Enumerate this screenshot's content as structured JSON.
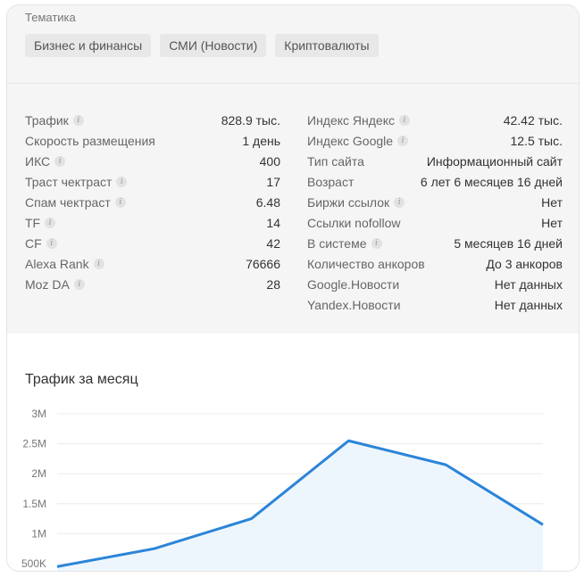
{
  "topics": {
    "title": "Тематика",
    "chips": [
      "Бизнес и финансы",
      "СМИ (Новости)",
      "Криптовалюты"
    ]
  },
  "stats": {
    "left": [
      {
        "label": "Трафик",
        "value": "828.9 тыс.",
        "info": true
      },
      {
        "label": "Скорость размещения",
        "value": "1 день",
        "info": false
      },
      {
        "label": "ИКС",
        "value": "400",
        "info": true
      },
      {
        "label": "Траст чектраст",
        "value": "17",
        "info": true
      },
      {
        "label": "Спам чектраст",
        "value": "6.48",
        "info": true
      },
      {
        "label": "TF",
        "value": "14",
        "info": true
      },
      {
        "label": "CF",
        "value": "42",
        "info": true
      },
      {
        "label": "Alexa Rank",
        "value": "76666",
        "info": true
      },
      {
        "label": "Moz DA",
        "value": "28",
        "info": true
      }
    ],
    "right": [
      {
        "label": "Индекс Яндекс",
        "value": "42.42 тыс.",
        "info": true
      },
      {
        "label": "Индекс Google",
        "value": "12.5 тыс.",
        "info": true
      },
      {
        "label": "Тип сайта",
        "value": "Информационный сайт",
        "info": false
      },
      {
        "label": "Возраст",
        "value": "6 лет 6 месяцев 16 дней",
        "info": false
      },
      {
        "label": "Биржи ссылок",
        "value": "Нет",
        "info": true
      },
      {
        "label": "Ссылки nofollow",
        "value": "Нет",
        "info": false
      },
      {
        "label": "В системе",
        "value": "5 месяцев 16 дней",
        "info": true
      },
      {
        "label": "Количество анкоров",
        "value": "До 3 анкоров",
        "info": false
      },
      {
        "label": "Google.Новости",
        "value": "Нет данных",
        "info": false
      },
      {
        "label": "Yandex.Новости",
        "value": "Нет данных",
        "info": false
      }
    ]
  },
  "chart_data": {
    "type": "area",
    "title": "Трафик за месяц",
    "y_ticks": [
      "3M",
      "2.5M",
      "2M",
      "1.5M",
      "1M",
      "500K"
    ],
    "y_tick_values": [
      3000000,
      2500000,
      2000000,
      1500000,
      1000000,
      500000
    ],
    "ylim": [
      500000,
      3000000
    ],
    "values": [
      450000,
      750000,
      1250000,
      2550000,
      2150000,
      1150000
    ],
    "line_color": "#2b85d8",
    "fill_color": "#eef6fd",
    "grid": true
  }
}
